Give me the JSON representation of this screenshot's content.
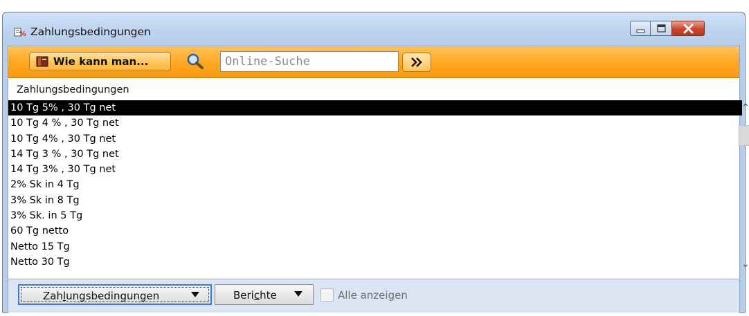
{
  "window": {
    "title": "Zahlungsbedingungen",
    "icon": "payment-terms-app-icon"
  },
  "toolbar": {
    "howto_label": "Wie kann man...",
    "howto_icon": "book-icon",
    "search_icon": "magnifier-icon",
    "search_placeholder": "Online-Suche",
    "go_icon": "double-chevron-right-icon"
  },
  "list": {
    "header": "Zahlungsbedingungen",
    "items": [
      {
        "label": "10 Tg  5% , 30 Tg net",
        "selected": true
      },
      {
        "label": "10 Tg 4 % , 30 Tg net",
        "selected": false
      },
      {
        "label": "10 Tg 4% , 30 Tg net",
        "selected": false
      },
      {
        "label": "14 Tg 3 % , 30 Tg net",
        "selected": false
      },
      {
        "label": "14 Tg 3% , 30 Tg net",
        "selected": false
      },
      {
        "label": "2% Sk in 4 Tg",
        "selected": false
      },
      {
        "label": "3% Sk in 8 Tg",
        "selected": false
      },
      {
        "label": "3% Sk. in 5 Tg",
        "selected": false
      },
      {
        "label": "60 Tg netto",
        "selected": false
      },
      {
        "label": "Netto 15 Tg",
        "selected": false
      },
      {
        "label": "Netto 30 Tg",
        "selected": false
      }
    ]
  },
  "bottom": {
    "zahlungsbedingungen_button": {
      "pre": "Zah",
      "underline": "l",
      "post": "ungsbedingungen"
    },
    "berichte_button": {
      "pre": "Beri",
      "underline": "c",
      "post": "hte"
    },
    "show_all": {
      "pre": "Alle anzei",
      "underline": "g",
      "post": "en",
      "checked": false,
      "enabled": false
    }
  },
  "colors": {
    "toolbar_orange": "#ffa621",
    "selection": "#000000",
    "window_frame": "#bcd2ee",
    "close_red": "#c9452e"
  }
}
